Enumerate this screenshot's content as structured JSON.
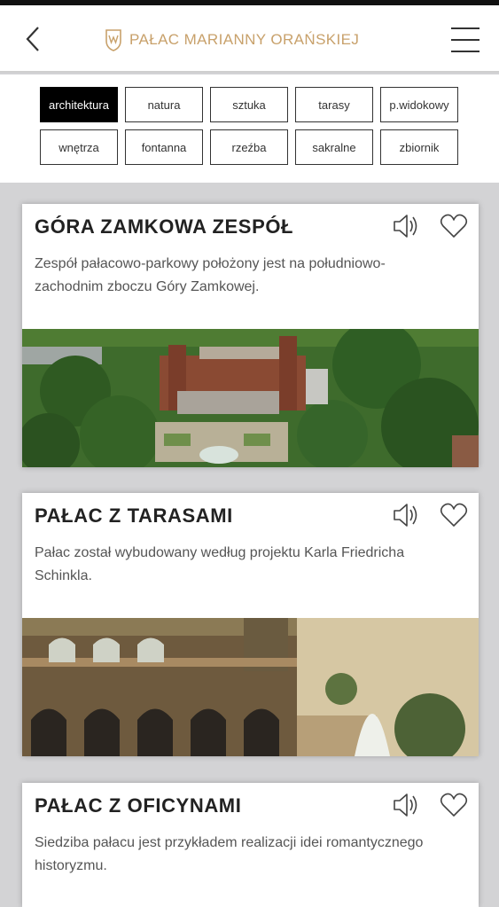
{
  "header": {
    "title": "PAŁAC MARIANNY ORAŃSKIEJ",
    "back_icon": "chevron-left-icon",
    "logo_icon": "crest-icon",
    "menu_icon": "hamburger-menu-icon",
    "accent_color": "#c8a16b"
  },
  "filters": [
    {
      "label": "architektura",
      "active": true
    },
    {
      "label": "natura",
      "active": false
    },
    {
      "label": "sztuka",
      "active": false
    },
    {
      "label": "tarasy",
      "active": false
    },
    {
      "label": "p.widokowy",
      "active": false
    },
    {
      "label": "wnętrza",
      "active": false
    },
    {
      "label": "fontanna",
      "active": false
    },
    {
      "label": "rzeźba",
      "active": false
    },
    {
      "label": "sakralne",
      "active": false
    },
    {
      "label": "zbiornik",
      "active": false
    }
  ],
  "cards": [
    {
      "title": "GÓRA ZAMKOWA ZESPÓŁ",
      "description": "Zespół pałacowo-parkowy położony jest na południowo-zachodnim zboczu Góry Zamkowej.",
      "image": "aerial-palace-photo"
    },
    {
      "title": "PAŁAC Z TARASAMI",
      "description": "Pałac został wybudowany według projektu Karla Friedricha Schinkla.",
      "image": "palace-terraces-postcard"
    },
    {
      "title": "PAŁAC Z OFICYNAMI",
      "description": "Siedziba pałacu jest przykładem realizacji idei romantycznego historyzmu.",
      "image": ""
    }
  ]
}
